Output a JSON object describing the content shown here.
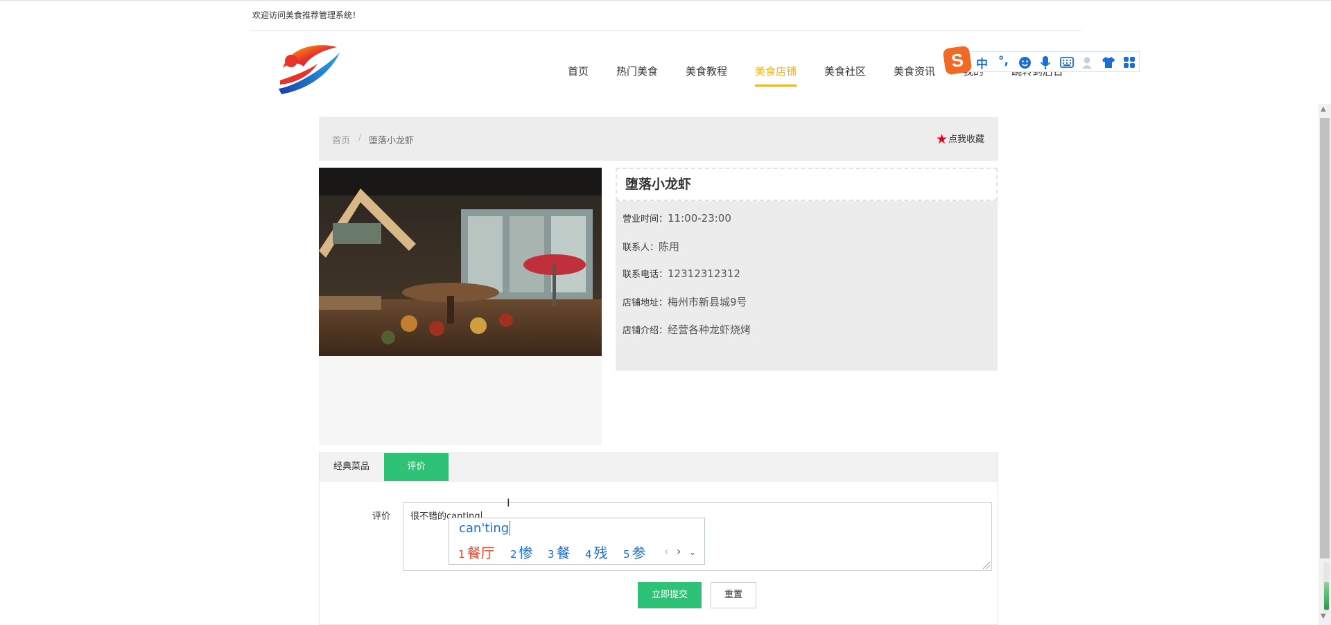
{
  "header": {
    "welcome": "欢迎访问美食推荐管理系统！"
  },
  "nav": {
    "items": [
      {
        "label": "首页"
      },
      {
        "label": "热门美食"
      },
      {
        "label": "美食教程"
      },
      {
        "label": "美食店铺"
      },
      {
        "label": "美食社区"
      },
      {
        "label": "美食资讯"
      },
      {
        "label": "我的"
      },
      {
        "label": "跳转到后台"
      }
    ],
    "active_index": 3
  },
  "ime_toolbar": {
    "logo": "S",
    "mode": "中",
    "punct": "°,"
  },
  "breadcrumb": {
    "home": "首页",
    "separator": "/",
    "current": "堕落小龙虾"
  },
  "favorite": {
    "label": "点我收藏"
  },
  "shop": {
    "title": "堕落小龙虾",
    "fields": [
      {
        "label": "营业时间：",
        "value": "11:00-23:00"
      },
      {
        "label": "联系人：",
        "value": "陈用"
      },
      {
        "label": "联系电话：",
        "value": "12312312312"
      },
      {
        "label": "店铺地址：",
        "value": "梅州市新县城9号"
      },
      {
        "label": "店铺介绍：",
        "value": "经营各种龙虾烧烤"
      }
    ]
  },
  "tabs": [
    {
      "label": "经典菜品"
    },
    {
      "label": "评价"
    }
  ],
  "comment": {
    "label": "评价",
    "value": "很不错的canting"
  },
  "ime_popup": {
    "pinyin": "can'ting",
    "candidates": [
      {
        "n": "1",
        "text": "餐厅"
      },
      {
        "n": "2",
        "text": "惨"
      },
      {
        "n": "3",
        "text": "餐"
      },
      {
        "n": "4",
        "text": "残"
      },
      {
        "n": "5",
        "text": "参"
      }
    ]
  },
  "buttons": {
    "submit": "立即提交",
    "reset": "重置"
  },
  "colors": {
    "accent_green": "#2dc275",
    "nav_active": "#f0b32a",
    "star": "#e60012",
    "ime_blue": "#1a6fd0"
  }
}
